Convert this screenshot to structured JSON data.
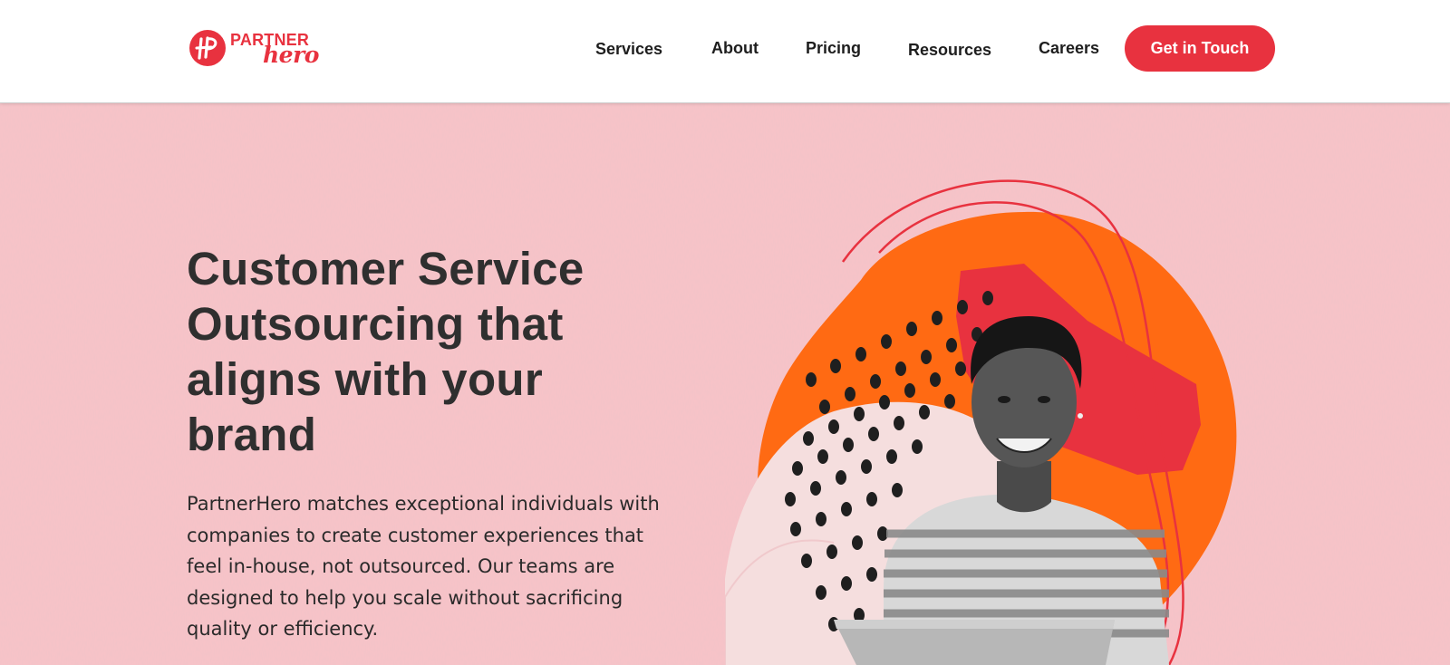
{
  "brand": {
    "logo_top": "PARTNER",
    "logo_bottom": "hero",
    "accent_color": "#e8323f",
    "logo_icon": "partnerhero-monogram-icon"
  },
  "nav": {
    "items": [
      {
        "label": "Services"
      },
      {
        "label": "About"
      },
      {
        "label": "Pricing"
      },
      {
        "label": "Resources"
      },
      {
        "label": "Careers"
      }
    ],
    "cta_label": "Get in Touch"
  },
  "hero": {
    "headline_lines": [
      "Customer Service",
      "Outsourcing that",
      "aligns with your",
      "brand"
    ],
    "body": "PartnerHero matches exceptional individuals with companies to create customer experiences that feel in-house, not outsourced. Our teams are designed to help you scale without sacrificing quality or efficiency.",
    "background_color": "#f7c3c8",
    "illustration": "smiling-person-with-laptop-collage"
  }
}
